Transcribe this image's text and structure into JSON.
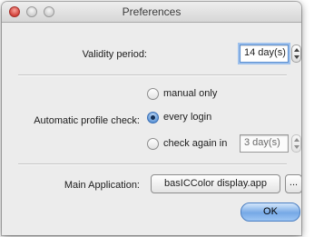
{
  "window": {
    "title": "Preferences",
    "controls": [
      "close-icon",
      "minimize-icon",
      "zoom-icon"
    ]
  },
  "validity": {
    "label": "Validity period:",
    "value": "14 day(s)"
  },
  "profile_check": {
    "label": "Automatic profile check:",
    "options": [
      {
        "label": "manual only",
        "selected": false
      },
      {
        "label": "every login",
        "selected": true
      },
      {
        "label": "check again in",
        "selected": false
      }
    ],
    "interval_value": "3 day(s)"
  },
  "main_app": {
    "label": "Main Application:",
    "value": "basICColor display.app",
    "browse_label": "..."
  },
  "ok_label": "OK",
  "colors": {
    "window_bg": "#ececec",
    "default_button": "#76a9e6",
    "focus_ring": "#9fc1ec"
  }
}
